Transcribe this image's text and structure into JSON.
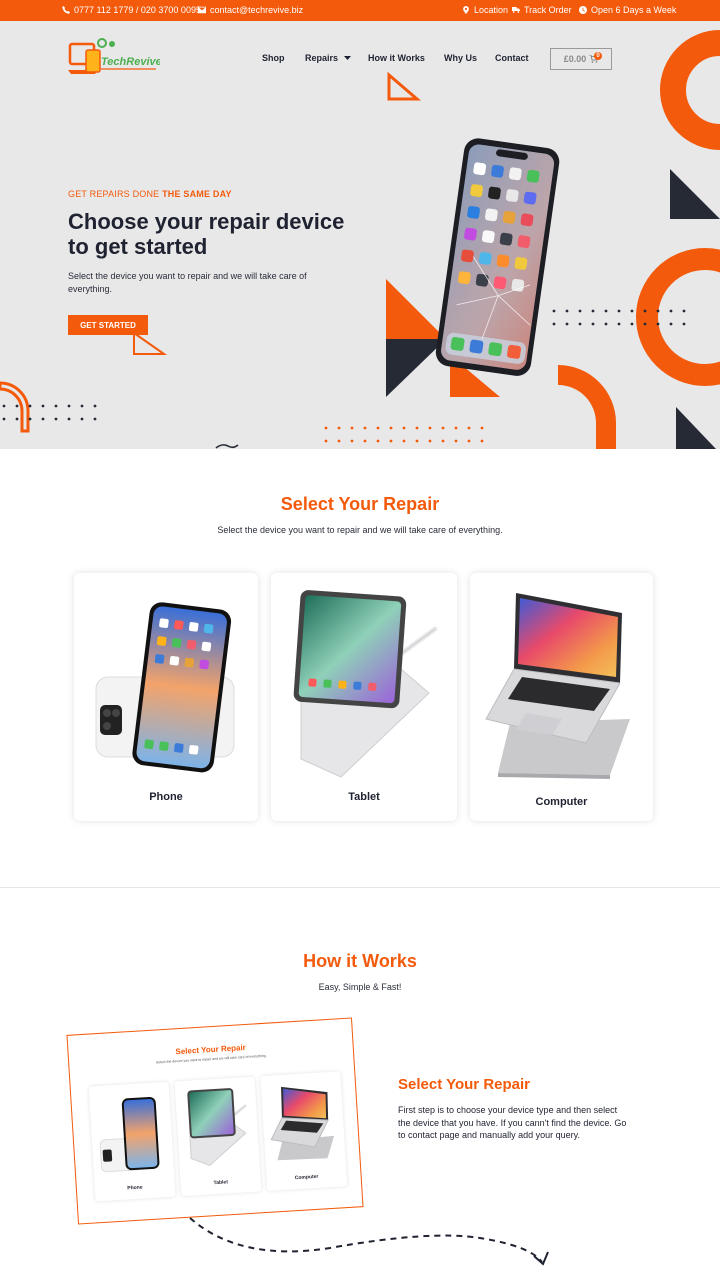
{
  "topbar": {
    "phone": "0777 112 1779 / 020 3700 0095",
    "email": "contact@techrevive.biz",
    "location": "Location",
    "track_order": "Track Order",
    "hours": "Open 6 Days a Week"
  },
  "brand": {
    "name": "TechRevive"
  },
  "nav": {
    "shop": "Shop",
    "repairs": "Repairs",
    "how_it_works": "How it Works",
    "why_us": "Why Us",
    "contact": "Contact"
  },
  "cart": {
    "total": "£0.00",
    "count": "0"
  },
  "hero": {
    "eyebrow_prefix": "GET REPAIRS DONE ",
    "eyebrow_bold": "THE SAME DAY",
    "title": "Choose your repair device to get started",
    "subtitle": "Select the device you want to repair and we will take care of everything.",
    "cta": "GET STARTED"
  },
  "repair_section": {
    "title": "Select Your Repair",
    "subtitle": "Select the device you want to repair and we will take care of everything.",
    "cards": [
      {
        "label": "Phone"
      },
      {
        "label": "Tablet"
      },
      {
        "label": "Computer"
      }
    ]
  },
  "how_it_works": {
    "title": "How it Works",
    "subtitle": "Easy, Simple & Fast!",
    "preview": {
      "title": "Select Your Repair",
      "subtitle": "Select the device you want to repair and we will take care of everything.",
      "cards": [
        "Phone",
        "Tablet",
        "Computer"
      ]
    },
    "step": {
      "title": "Select Your Repair",
      "text": "First step is to choose your device type and then select the device that you have. If you cann't find the device. Go to contact page and manually add your query."
    }
  },
  "colors": {
    "accent": "#f35a0b",
    "dark": "#262a35",
    "hero_bg": "#e8e8e9"
  }
}
